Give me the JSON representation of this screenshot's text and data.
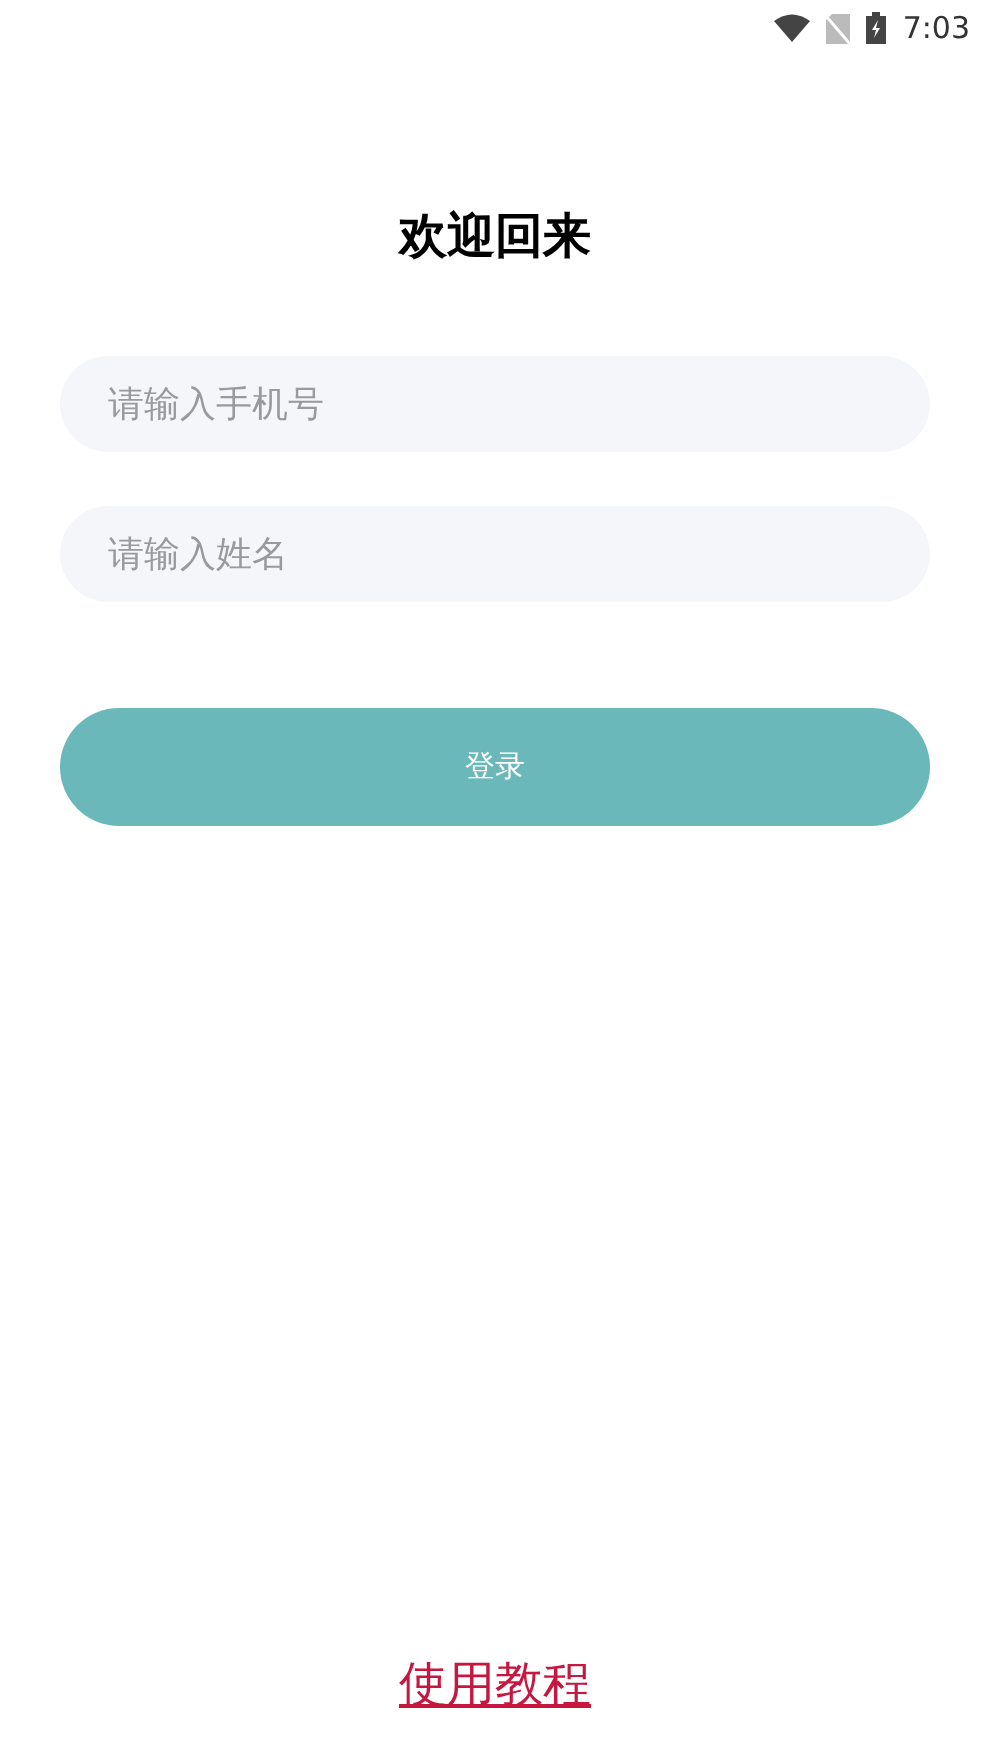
{
  "status_bar": {
    "time": "7:03"
  },
  "title": "欢迎回来",
  "fields": [
    {
      "placeholder": "请输入手机号"
    },
    {
      "placeholder": "请输入姓名"
    }
  ],
  "login_button": "登录",
  "tutorial_link": "使用教程"
}
